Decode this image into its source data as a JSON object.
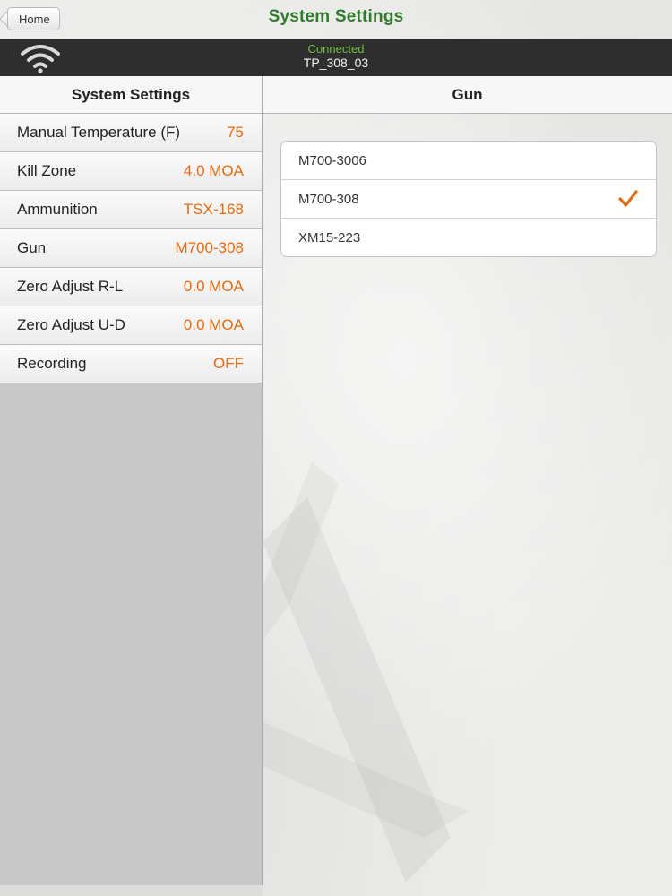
{
  "nav": {
    "home_label": "Home",
    "title": "System Settings",
    "title_color": "#2f7d2a"
  },
  "status": {
    "connection_state": "Connected",
    "device_name": "TP_308_03",
    "icon": "wifi-icon",
    "connected_color": "#6fbf3d"
  },
  "settings_panel": {
    "header": "System Settings",
    "value_color": "#e96a0c",
    "items": [
      {
        "label": "Manual Temperature (F)",
        "value": "75"
      },
      {
        "label": "Kill Zone",
        "value": "4.0 MOA"
      },
      {
        "label": "Ammunition",
        "value": "TSX-168"
      },
      {
        "label": "Gun",
        "value": "M700-308"
      },
      {
        "label": "Zero Adjust R-L",
        "value": "0.0 MOA"
      },
      {
        "label": "Zero Adjust U-D",
        "value": "0.0 MOA"
      },
      {
        "label": "Recording",
        "value": "OFF"
      }
    ]
  },
  "gun_panel": {
    "header": "Gun",
    "selected_index": 1,
    "check_icon": "checkmark-icon",
    "options": [
      {
        "name": "M700-3006",
        "selected": false
      },
      {
        "name": "M700-308",
        "selected": true
      },
      {
        "name": "XM15-223",
        "selected": false
      }
    ]
  }
}
